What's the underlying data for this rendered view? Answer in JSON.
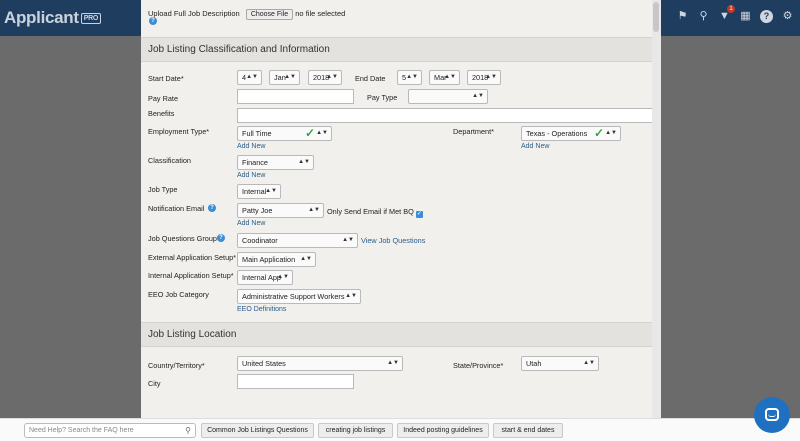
{
  "app": {
    "logo_text": "Applicant",
    "logo_badge": "PRO",
    "notification_count": "1"
  },
  "header_icons": [
    "bookmark-icon",
    "search-icon",
    "notification-icon",
    "calendar-icon",
    "help-icon",
    "settings-icon"
  ],
  "upload": {
    "label": "Upload Full Job Description",
    "button": "Choose File",
    "status": "no file selected"
  },
  "sections": {
    "classification": "Job Listing Classification and Information",
    "location": "Job Listing Location"
  },
  "form": {
    "start_date": {
      "label": "Start Date*",
      "day": "4",
      "month": "Jan",
      "year": "2018"
    },
    "end_date": {
      "label": "End Date",
      "day": "5",
      "month": "Mar",
      "year": "2018"
    },
    "pay_rate": {
      "label": "Pay Rate",
      "value": ""
    },
    "pay_type": {
      "label": "Pay Type",
      "value": ""
    },
    "benefits": {
      "label": "Benefits",
      "value": ""
    },
    "employment_type": {
      "label": "Employment Type*",
      "value": "Full Time",
      "add_new": "Add New"
    },
    "department": {
      "label": "Department*",
      "value": "Texas - Operations",
      "add_new": "Add New"
    },
    "classification": {
      "label": "Classification",
      "value": "Finance",
      "add_new": "Add New"
    },
    "job_type": {
      "label": "Job Type",
      "value": "Internal"
    },
    "notification_email": {
      "label": "Notification Email",
      "value": "Patty Joe",
      "checkbox_label": "Only Send Email if Met BQ",
      "add_new": "Add New"
    },
    "job_questions_group": {
      "label": "Job Questions Group",
      "value": "Coodinator",
      "link": "View Job Questions"
    },
    "external_application": {
      "label": "External Application Setup*",
      "value": "Main Application"
    },
    "internal_application": {
      "label": "Internal Application Setup*",
      "value": "Internal App"
    },
    "eeo_category": {
      "label": "EEO Job Category",
      "value": "Administrative Support Workers",
      "link": "EEO Definitions"
    },
    "country": {
      "label": "Country/Territory*",
      "value": "United States"
    },
    "state": {
      "label": "State/Province*",
      "value": "Utah"
    },
    "city": {
      "label": "City",
      "value": ""
    }
  },
  "help_bar": {
    "search_placeholder": "Need Help? Search the FAQ here",
    "buttons": [
      "Common Job Listings Questions",
      "creating job listings",
      "Indeed posting guidelines",
      "start & end dates"
    ]
  }
}
